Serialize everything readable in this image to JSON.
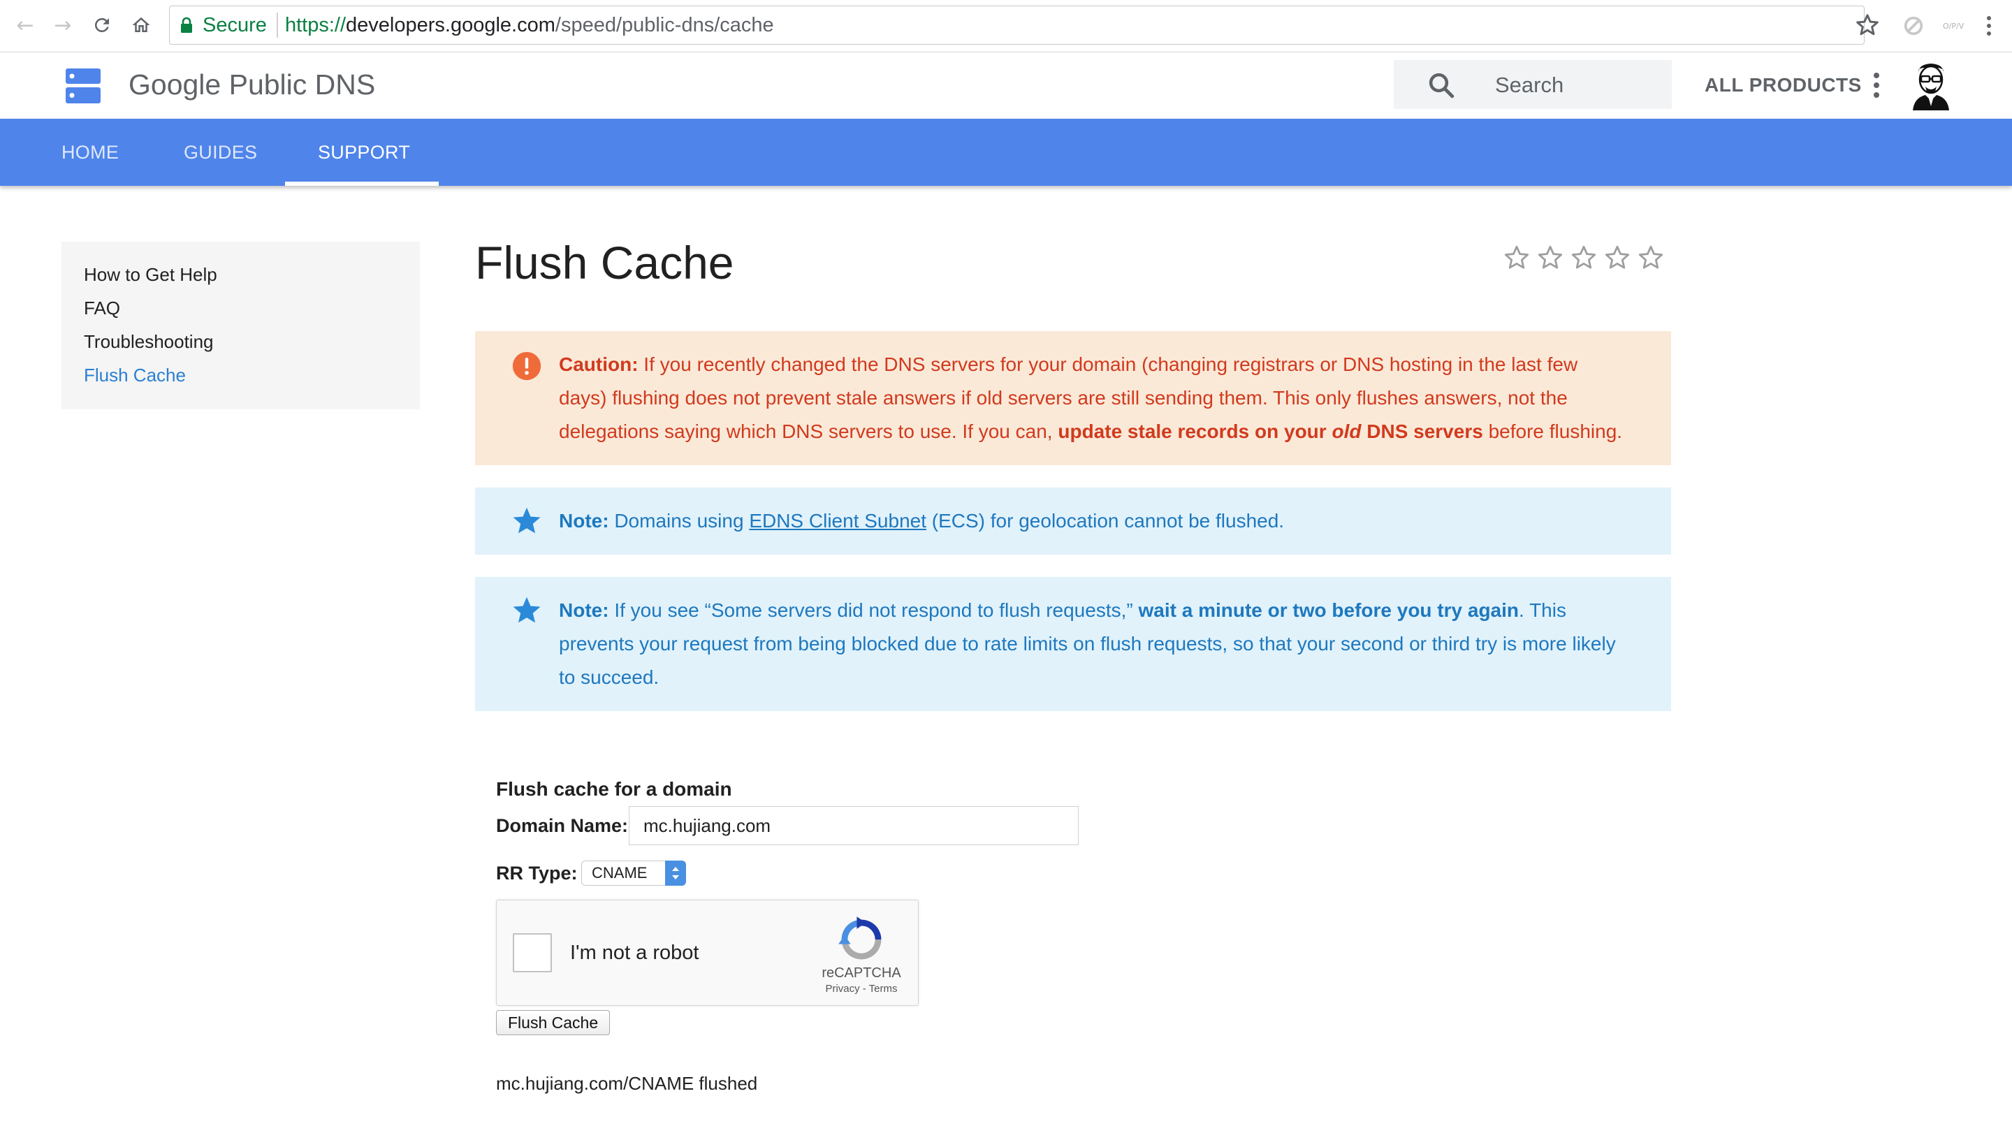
{
  "browser": {
    "secure_label": "Secure",
    "url_scheme": "https://",
    "url_host": "developers.google.com",
    "url_path": "/speed/public-dns/cache"
  },
  "header": {
    "product_name": "Google Public DNS",
    "search_placeholder": "Search",
    "all_products": "ALL PRODUCTS"
  },
  "tabs": [
    {
      "label": "HOME"
    },
    {
      "label": "GUIDES"
    },
    {
      "label": "SUPPORT",
      "active": true
    }
  ],
  "sidebar": {
    "items": [
      {
        "label": "How to Get Help"
      },
      {
        "label": "FAQ"
      },
      {
        "label": "Troubleshooting"
      },
      {
        "label": "Flush Cache",
        "active": true
      }
    ]
  },
  "page": {
    "title": "Flush Cache",
    "rating_stars": 5
  },
  "caution": {
    "lead": "Caution:",
    "text1": " If you recently changed the DNS servers for your domain (changing registrars or DNS hosting in the last few days) flushing does not prevent stale answers if old servers are still sending them. This only flushes answers, not the delegations saying which DNS servers to use. If you can, ",
    "bold1": "update stale records on your ",
    "bold_italic": "old",
    "bold2": " DNS servers",
    "text2": " before flushing."
  },
  "note1": {
    "lead": "Note:",
    "text1": " Domains using ",
    "link": "EDNS Client Subnet",
    "text2": " (ECS) for geolocation cannot be flushed."
  },
  "note2": {
    "lead": "Note:",
    "text1": " If you see “Some servers did not respond to flush requests,” ",
    "bold": "wait a minute or two before you try again",
    "text2": ". This prevents your request from being blocked due to rate limits on flush requests, so that your second or third try is more likely to succeed."
  },
  "form": {
    "title": "Flush cache for a domain",
    "domain_label": "Domain Name:",
    "domain_value": "mc.hujiang.com",
    "rr_label": "RR Type:",
    "rr_value": "CNAME",
    "captcha_label": "I'm not a robot",
    "captcha_brand": "reCAPTCHA",
    "captcha_links": "Privacy - Terms",
    "button_label": "Flush Cache",
    "result": "mc.hujiang.com/CNAME flushed"
  },
  "colors": {
    "brand_blue": "#4f84ea",
    "caution_bg": "#fbe9d8",
    "caution_text": "#d13a1e",
    "note_bg": "#e1f2fb",
    "note_text": "#1e78be",
    "secure_green": "#0b8043"
  }
}
